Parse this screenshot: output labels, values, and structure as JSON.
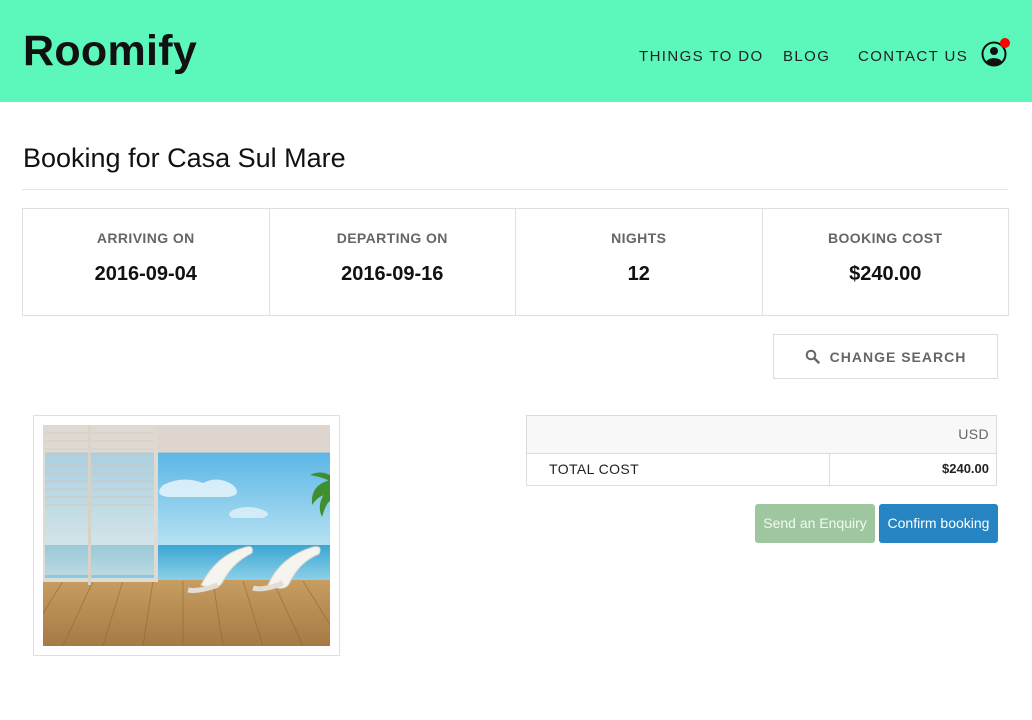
{
  "header": {
    "brand": "Roomify",
    "nav": [
      "THINGS TO DO",
      "BLOG",
      "CONTACT US"
    ],
    "user_icon": "user-circle-icon",
    "notification_color": "#ff0000",
    "background": "#5cf7bb"
  },
  "page": {
    "title": "Booking for Casa Sul Mare"
  },
  "summary": [
    {
      "label": "ARRIVING ON",
      "value": "2016-09-04"
    },
    {
      "label": "DEPARTING ON",
      "value": "2016-09-16"
    },
    {
      "label": "NIGHTS",
      "value": "12"
    },
    {
      "label": "BOOKING COST",
      "value": "$240.00"
    }
  ],
  "change_search": {
    "icon": "search-icon",
    "label": "CHANGE SEARCH"
  },
  "cost_table": {
    "currency": "USD",
    "rows": [
      {
        "label": "TOTAL COST",
        "amount": "$240.00"
      }
    ]
  },
  "actions": {
    "enquiry_label": "Send an Enquiry",
    "confirm_label": "Confirm booking",
    "enquiry_color": "#9fc79f",
    "confirm_color": "#2684c2"
  }
}
